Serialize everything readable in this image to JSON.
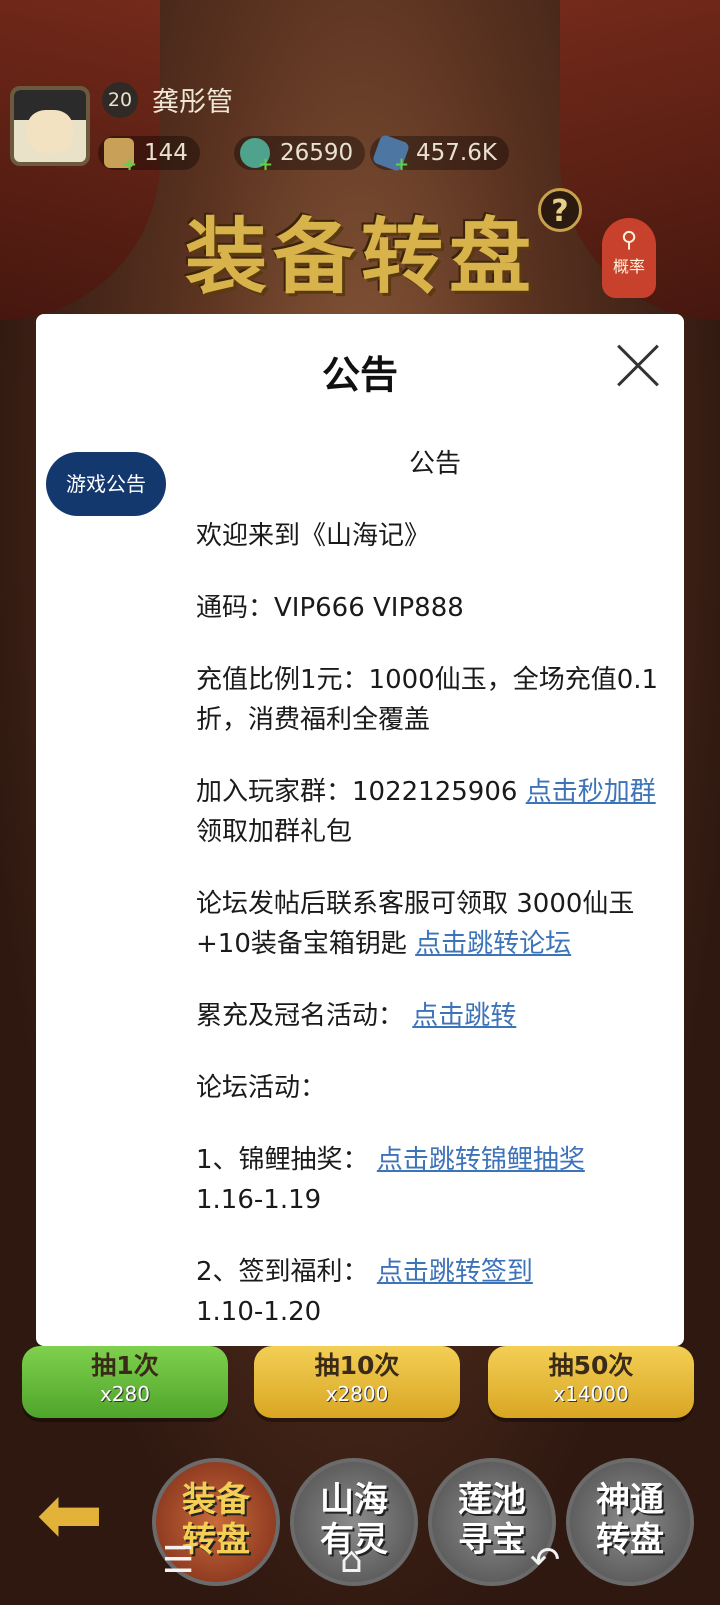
{
  "player": {
    "level": "20",
    "name": "龚彤管"
  },
  "resources": [
    {
      "icon": "scroll-icon",
      "value": "144"
    },
    {
      "icon": "jade-icon",
      "value": "26590"
    },
    {
      "icon": "crystal-icon",
      "value": "457.6K"
    }
  ],
  "game": {
    "title": "装备转盘",
    "rate_label": "概率"
  },
  "draws": [
    {
      "label": "抽1次",
      "cost": "x280"
    },
    {
      "label": "抽10次",
      "cost": "x2800"
    },
    {
      "label": "抽50次",
      "cost": "x14000"
    }
  ],
  "tabs": [
    {
      "line1": "装备",
      "line2": "转盘"
    },
    {
      "line1": "山海",
      "line2": "有灵"
    },
    {
      "line1": "莲池",
      "line2": "寻宝"
    },
    {
      "line1": "神通",
      "line2": "转盘"
    }
  ],
  "modal": {
    "title": "公告",
    "side_tab": "游戏公告",
    "heading": "公告",
    "welcome": "欢迎来到《山海记》",
    "code": "通码：VIP666 VIP888",
    "ratio": "充值比例1元：1000仙玉，全场充值0.1折，消费福利全覆盖",
    "group_text": "加入玩家群：1022125906 ",
    "group_link": "点击秒加群",
    "group_after": " 领取加群礼包",
    "forum_text": "论坛发帖后联系客服可领取 3000仙玉+10装备宝箱钥匙 ",
    "forum_link": "点击跳转论坛",
    "event_text": "累充及冠名活动：  ",
    "event_link": "点击跳转",
    "forum_events": "论坛活动：",
    "item1_text": "1、锦鲤抽奖：  ",
    "item1_link": "点击跳转锦鲤抽奖",
    "item1_date": "1.16-1.19",
    "item2_text": "2、签到福利：  ",
    "item2_link": "点击跳转签到",
    "item2_date": "1.10-1.20"
  }
}
